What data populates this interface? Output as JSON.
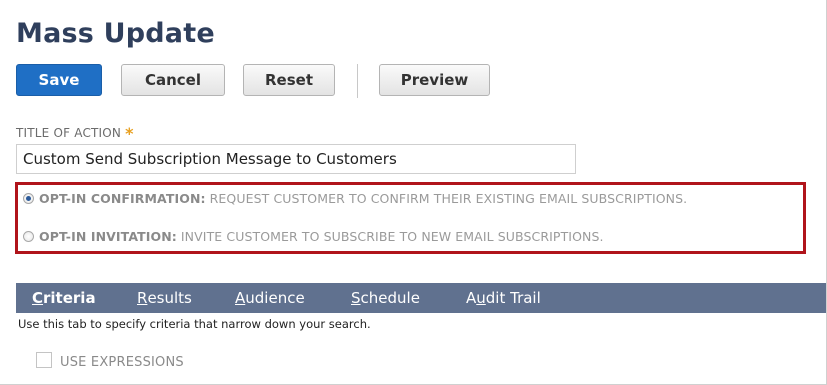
{
  "page": {
    "title": "Mass Update"
  },
  "toolbar": {
    "save_label": "Save",
    "cancel_label": "Cancel",
    "reset_label": "Reset",
    "preview_label": "Preview"
  },
  "form": {
    "title_label": "TITLE OF ACTION",
    "required_marker": "*",
    "title_value": "Custom Send Subscription Message to Customers"
  },
  "options": [
    {
      "label": "OPT-IN CONFIRMATION:",
      "description": "REQUEST CUSTOMER TO CONFIRM THEIR EXISTING EMAIL SUBSCRIPTIONS.",
      "selected": true
    },
    {
      "label": "OPT-IN INVITATION:",
      "description": "INVITE CUSTOMER TO SUBSCRIBE TO NEW EMAIL SUBSCRIPTIONS.",
      "selected": false
    }
  ],
  "tabs": [
    {
      "first": "C",
      "rest": "riteria",
      "active": true
    },
    {
      "first": "R",
      "rest": "esults",
      "active": false
    },
    {
      "first": "A",
      "rest": "udience",
      "active": false
    },
    {
      "first": "S",
      "rest": "chedule",
      "active": false
    },
    {
      "pre": "A",
      "first": "u",
      "rest": "dit Trail",
      "active": false
    }
  ],
  "criteria": {
    "help_text": "Use this tab to specify criteria that narrow down your search.",
    "use_expressions_label": "USE EXPRESSIONS",
    "use_expressions_checked": false
  },
  "colors": {
    "title": "#2f3f5c",
    "primary_button": "#1f6fc5",
    "highlight_border": "#b0141b",
    "tabbar": "#60718f",
    "required_star": "#e8a020"
  }
}
